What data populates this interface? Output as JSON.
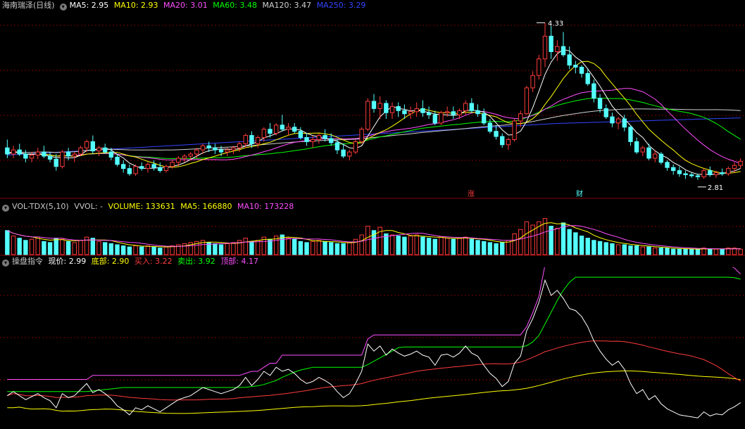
{
  "colors": {
    "up": "#ff3b3b",
    "down": "#54ffff",
    "ma5": "#ffffff",
    "ma10": "#ffff00",
    "ma20": "#ff4fff",
    "ma60": "#00ff00",
    "ma120": "#d0d0d0",
    "ma250": "#3344ff",
    "grid": "#7a0000"
  },
  "header": {
    "title": "海南瑞泽(日线)",
    "ma5": "MA5: 2.95",
    "ma10": "MA10: 2.93",
    "ma20": "MA20: 3.01",
    "ma60": "MA60: 3.48",
    "ma120": "MA120: 3.47",
    "ma250": "MA250: 3.29"
  },
  "volume_header": {
    "name": "VOL-TDX(5,10)",
    "vvol": "VVOL: -",
    "volume": "VOLUME: 133631",
    "ma5": "MA5: 166880",
    "ma10": "MA10: 173228"
  },
  "indicator_header": {
    "name": "操盘指令",
    "price": "现价: 2.99",
    "bottom": "底部: 2.90",
    "buy": "买入: 3.22",
    "sell": "卖出: 3.92",
    "top": "顶部: 4.17"
  },
  "annotations": {
    "high_label": "4.33",
    "low_label": "2.81",
    "marker_zhang": "涨",
    "marker_cai": "财"
  },
  "chart_data": {
    "type": "candlestick",
    "price_ylim": [
      2.7,
      4.4
    ],
    "ohlc": [
      [
        3.12,
        3.2,
        3.02,
        3.06
      ],
      [
        3.06,
        3.14,
        3.02,
        3.1
      ],
      [
        3.1,
        3.16,
        3.04,
        3.06
      ],
      [
        3.06,
        3.1,
        2.98,
        3.02
      ],
      [
        3.02,
        3.08,
        2.98,
        3.05
      ],
      [
        3.05,
        3.12,
        3.01,
        3.08
      ],
      [
        3.08,
        3.14,
        3.02,
        3.04
      ],
      [
        3.04,
        3.08,
        2.98,
        3.01
      ],
      [
        3.01,
        3.06,
        2.9,
        2.94
      ],
      [
        2.94,
        3.1,
        2.92,
        3.08
      ],
      [
        3.08,
        3.12,
        3.0,
        3.04
      ],
      [
        3.04,
        3.08,
        2.98,
        3.06
      ],
      [
        3.06,
        3.14,
        3.04,
        3.12
      ],
      [
        3.12,
        3.2,
        3.08,
        3.18
      ],
      [
        3.18,
        3.24,
        3.06,
        3.09
      ],
      [
        3.09,
        3.14,
        3.04,
        3.12
      ],
      [
        3.12,
        3.16,
        3.06,
        3.08
      ],
      [
        3.08,
        3.12,
        3.0,
        3.03
      ],
      [
        3.03,
        3.06,
        2.94,
        2.96
      ],
      [
        2.96,
        3.0,
        2.88,
        2.92
      ],
      [
        2.92,
        2.96,
        2.85,
        2.87
      ],
      [
        2.87,
        2.96,
        2.85,
        2.94
      ],
      [
        2.94,
        2.98,
        2.9,
        2.92
      ],
      [
        2.92,
        2.98,
        2.88,
        2.96
      ],
      [
        2.96,
        3.0,
        2.9,
        2.93
      ],
      [
        2.93,
        2.98,
        2.88,
        2.9
      ],
      [
        2.9,
        2.96,
        2.88,
        2.94
      ],
      [
        2.94,
        3.0,
        2.92,
        2.98
      ],
      [
        2.98,
        3.04,
        2.94,
        3.02
      ],
      [
        3.02,
        3.06,
        2.98,
        3.04
      ],
      [
        3.04,
        3.08,
        3.0,
        3.06
      ],
      [
        3.06,
        3.12,
        3.02,
        3.1
      ],
      [
        3.1,
        3.16,
        3.06,
        3.14
      ],
      [
        3.14,
        3.18,
        3.08,
        3.12
      ],
      [
        3.12,
        3.16,
        3.06,
        3.1
      ],
      [
        3.1,
        3.14,
        3.04,
        3.08
      ],
      [
        3.08,
        3.12,
        3.04,
        3.1
      ],
      [
        3.1,
        3.14,
        3.06,
        3.12
      ],
      [
        3.12,
        3.18,
        3.08,
        3.16
      ],
      [
        3.16,
        3.26,
        3.12,
        3.24
      ],
      [
        3.24,
        3.28,
        3.12,
        3.16
      ],
      [
        3.16,
        3.24,
        3.12,
        3.22
      ],
      [
        3.22,
        3.32,
        3.18,
        3.3
      ],
      [
        3.3,
        3.36,
        3.22,
        3.26
      ],
      [
        3.26,
        3.36,
        3.24,
        3.34
      ],
      [
        3.34,
        3.44,
        3.28,
        3.3
      ],
      [
        3.3,
        3.36,
        3.24,
        3.32
      ],
      [
        3.32,
        3.36,
        3.26,
        3.28
      ],
      [
        3.28,
        3.32,
        3.2,
        3.22
      ],
      [
        3.22,
        3.26,
        3.14,
        3.18
      ],
      [
        3.18,
        3.24,
        3.12,
        3.2
      ],
      [
        3.2,
        3.26,
        3.16,
        3.24
      ],
      [
        3.24,
        3.3,
        3.18,
        3.21
      ],
      [
        3.21,
        3.26,
        3.14,
        3.17
      ],
      [
        3.17,
        3.2,
        3.06,
        3.1
      ],
      [
        3.1,
        3.16,
        3.02,
        3.04
      ],
      [
        3.04,
        3.1,
        3.0,
        3.08
      ],
      [
        3.08,
        3.2,
        3.06,
        3.18
      ],
      [
        3.18,
        3.32,
        3.16,
        3.3
      ],
      [
        3.3,
        3.6,
        3.28,
        3.57
      ],
      [
        3.57,
        3.64,
        3.46,
        3.5
      ],
      [
        3.5,
        3.62,
        3.4,
        3.55
      ],
      [
        3.55,
        3.58,
        3.4,
        3.46
      ],
      [
        3.46,
        3.56,
        3.4,
        3.52
      ],
      [
        3.52,
        3.56,
        3.42,
        3.48
      ],
      [
        3.48,
        3.54,
        3.4,
        3.45
      ],
      [
        3.45,
        3.52,
        3.4,
        3.47
      ],
      [
        3.47,
        3.56,
        3.42,
        3.5
      ],
      [
        3.5,
        3.58,
        3.42,
        3.46
      ],
      [
        3.46,
        3.52,
        3.4,
        3.44
      ],
      [
        3.44,
        3.48,
        3.34,
        3.36
      ],
      [
        3.36,
        3.48,
        3.34,
        3.46
      ],
      [
        3.46,
        3.52,
        3.42,
        3.47
      ],
      [
        3.47,
        3.52,
        3.4,
        3.44
      ],
      [
        3.44,
        3.5,
        3.4,
        3.48
      ],
      [
        3.48,
        3.58,
        3.44,
        3.55
      ],
      [
        3.55,
        3.6,
        3.46,
        3.48
      ],
      [
        3.48,
        3.54,
        3.42,
        3.45
      ],
      [
        3.45,
        3.5,
        3.34,
        3.36
      ],
      [
        3.36,
        3.4,
        3.26,
        3.28
      ],
      [
        3.28,
        3.34,
        3.2,
        3.23
      ],
      [
        3.23,
        3.26,
        3.12,
        3.15
      ],
      [
        3.15,
        3.22,
        3.1,
        3.2
      ],
      [
        3.2,
        3.4,
        3.18,
        3.38
      ],
      [
        3.38,
        3.48,
        3.32,
        3.45
      ],
      [
        3.45,
        3.72,
        3.44,
        3.7
      ],
      [
        3.7,
        3.86,
        3.66,
        3.82
      ],
      [
        3.82,
        4.02,
        3.78,
        3.98
      ],
      [
        3.98,
        4.33,
        3.9,
        4.2
      ],
      [
        4.2,
        4.3,
        3.98,
        4.05
      ],
      [
        4.05,
        4.16,
        3.96,
        4.1
      ],
      [
        4.1,
        4.24,
        4.0,
        4.02
      ],
      [
        4.02,
        4.1,
        3.88,
        3.92
      ],
      [
        3.92,
        3.96,
        3.84,
        3.9
      ],
      [
        3.9,
        3.92,
        3.8,
        3.84
      ],
      [
        3.84,
        3.88,
        3.72,
        3.74
      ],
      [
        3.74,
        3.78,
        3.56,
        3.6
      ],
      [
        3.6,
        3.64,
        3.46,
        3.5
      ],
      [
        3.5,
        3.54,
        3.4,
        3.42
      ],
      [
        3.42,
        3.46,
        3.32,
        3.36
      ],
      [
        3.36,
        3.42,
        3.3,
        3.4
      ],
      [
        3.4,
        3.44,
        3.28,
        3.32
      ],
      [
        3.32,
        3.34,
        3.14,
        3.18
      ],
      [
        3.18,
        3.22,
        3.06,
        3.08
      ],
      [
        3.08,
        3.14,
        3.04,
        3.12
      ],
      [
        3.12,
        3.16,
        3.0,
        3.02
      ],
      [
        3.02,
        3.1,
        2.98,
        3.06
      ],
      [
        3.06,
        3.08,
        2.96,
        2.98
      ],
      [
        2.98,
        3.0,
        2.9,
        2.93
      ],
      [
        2.93,
        2.96,
        2.86,
        2.9
      ],
      [
        2.9,
        2.94,
        2.84,
        2.87
      ],
      [
        2.87,
        2.9,
        2.82,
        2.86
      ],
      [
        2.86,
        2.88,
        2.83,
        2.85
      ],
      [
        2.85,
        2.87,
        2.81,
        2.84
      ],
      [
        2.84,
        2.92,
        2.82,
        2.9
      ],
      [
        2.9,
        2.94,
        2.84,
        2.86
      ],
      [
        2.86,
        2.9,
        2.83,
        2.88
      ],
      [
        2.88,
        2.92,
        2.85,
        2.87
      ],
      [
        2.87,
        2.94,
        2.85,
        2.92
      ],
      [
        2.92,
        2.98,
        2.88,
        2.95
      ],
      [
        2.95,
        3.02,
        2.92,
        2.99
      ]
    ],
    "volume": [
      2.2,
      1.7,
      1.5,
      1.3,
      1.4,
      1.6,
      1.2,
      1.1,
      1.5,
      1.4,
      1.2,
      1.1,
      1.3,
      1.6,
      1.5,
      1.2,
      1.1,
      1.0,
      0.9,
      0.8,
      0.7,
      0.8,
      0.7,
      0.8,
      0.7,
      0.6,
      0.7,
      0.8,
      0.9,
      1.0,
      1.1,
      1.2,
      1.3,
      1.1,
      1.0,
      0.9,
      1.0,
      1.1,
      1.3,
      1.5,
      1.2,
      1.3,
      1.6,
      1.4,
      1.7,
      1.8,
      1.5,
      1.4,
      1.2,
      1.1,
      1.2,
      1.3,
      1.2,
      1.1,
      1.0,
      1.0,
      1.1,
      1.4,
      1.8,
      2.6,
      2.2,
      2.5,
      1.9,
      1.8,
      1.7,
      1.6,
      1.7,
      1.8,
      1.6,
      1.5,
      1.4,
      1.6,
      1.5,
      1.4,
      1.5,
      1.6,
      1.4,
      1.3,
      1.2,
      1.1,
      1.0,
      1.1,
      1.3,
      1.9,
      2.3,
      3.0,
      2.7,
      3.0,
      3.3,
      2.6,
      2.4,
      2.9,
      2.3,
      2.0,
      1.7,
      1.5,
      1.3,
      1.2,
      1.1,
      1.0,
      0.9,
      0.9,
      0.8,
      0.8,
      0.7,
      0.7,
      0.6,
      0.6,
      0.6,
      0.5,
      0.5,
      0.5,
      0.5,
      0.5,
      0.6,
      0.5,
      0.5,
      0.5,
      0.6,
      0.6,
      0.5
    ],
    "volume_ylim": [
      0,
      3.6
    ]
  }
}
